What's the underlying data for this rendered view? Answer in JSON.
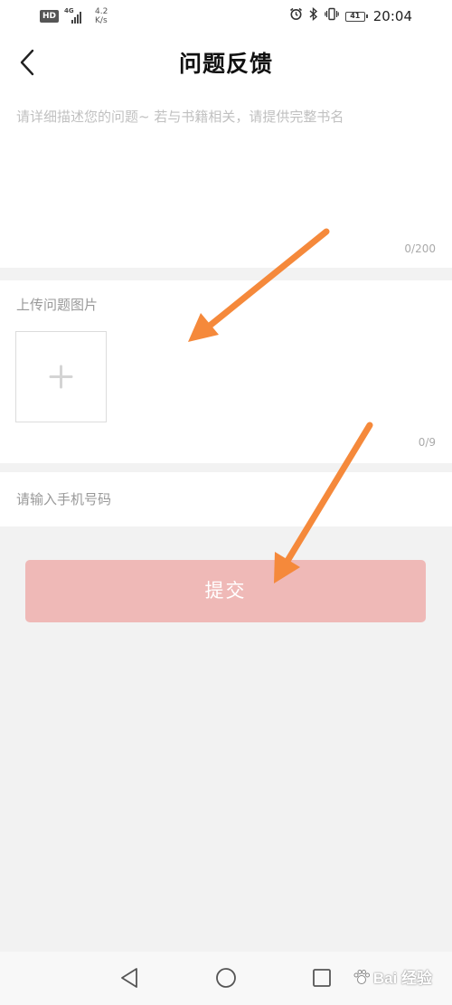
{
  "status_bar": {
    "hd_label": "HD",
    "network_label": "4G",
    "net_speed_value": "4.2",
    "net_speed_unit": "K/s",
    "battery_level": "41",
    "time": "20:04",
    "icons": [
      "alarm-icon",
      "bluetooth-icon",
      "vibrate-icon",
      "battery-icon"
    ]
  },
  "header": {
    "title": "问题反馈",
    "back_icon": "chevron-left-icon"
  },
  "description": {
    "placeholder": "请详细描述您的问题~ 若与书籍相关，请提供完整书名",
    "value": "",
    "counter": "0/200"
  },
  "upload": {
    "label": "上传问题图片",
    "add_icon": "plus-icon",
    "counter": "0/9"
  },
  "phone": {
    "placeholder": "请输入手机号码",
    "value": ""
  },
  "submit": {
    "label": "提交"
  },
  "system_nav": {
    "icons": [
      "back-triangle-icon",
      "home-circle-icon",
      "recents-square-icon"
    ]
  },
  "watermark": {
    "text": "Bai 经验"
  },
  "colors": {
    "submit_bg": "#efb9b7",
    "annotation_arrow": "#f5893b",
    "page_bg": "#f2f2f2",
    "section_bg": "#ffffff"
  }
}
